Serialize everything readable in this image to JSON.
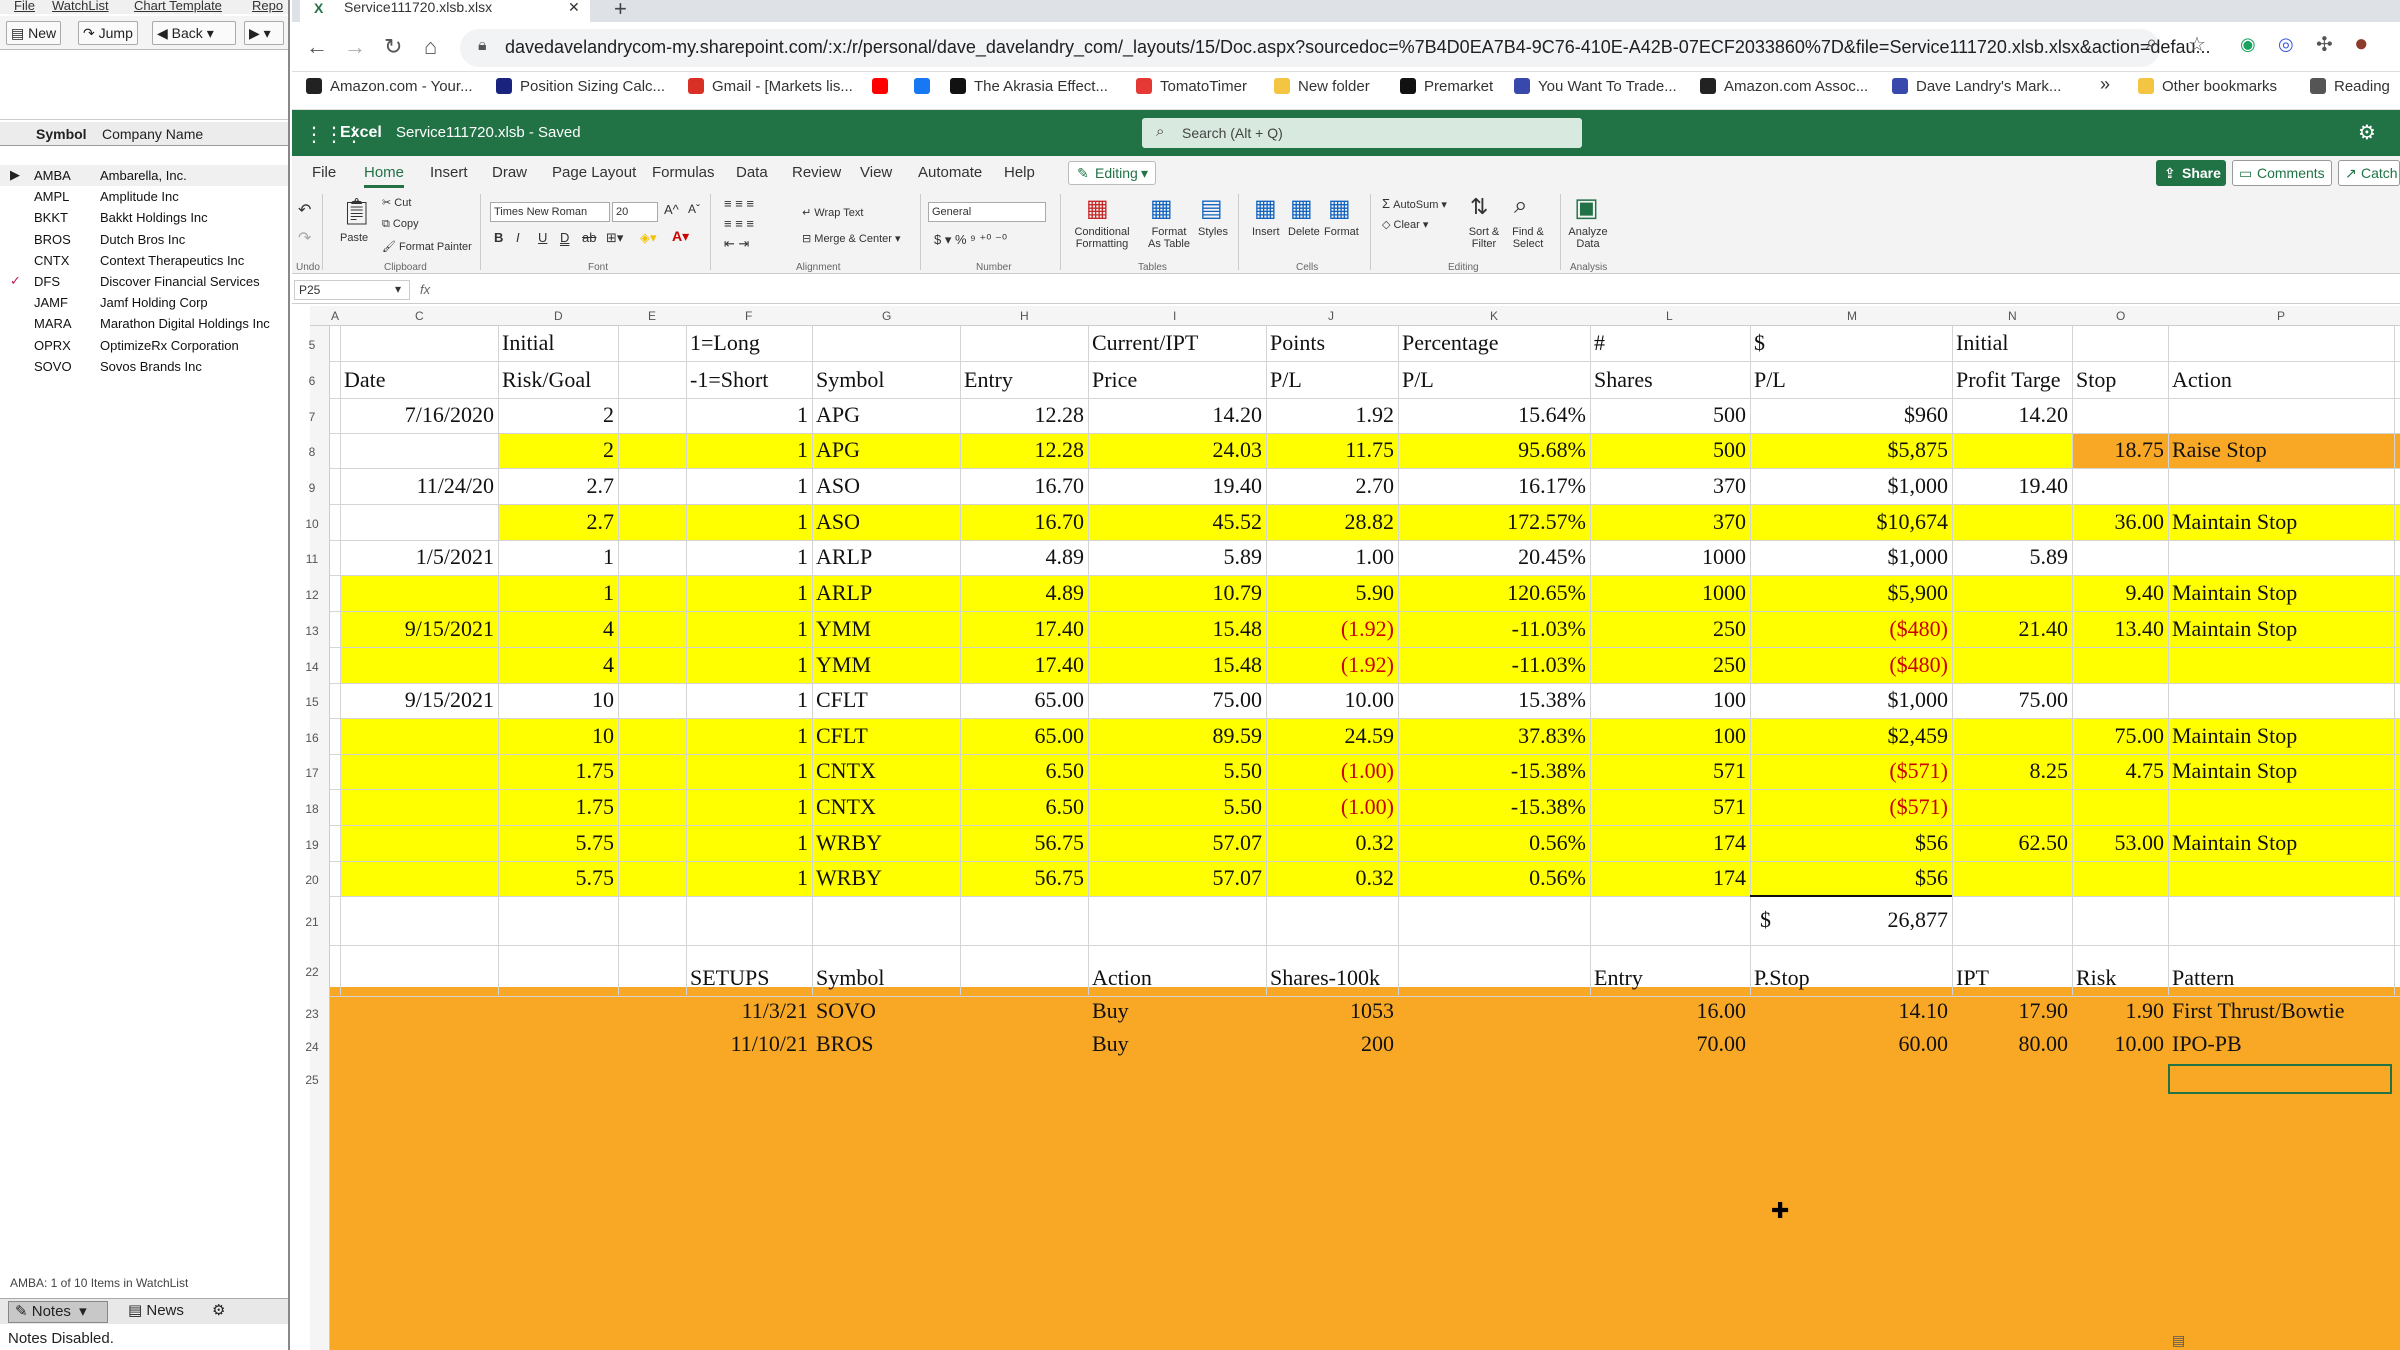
{
  "left_app": {
    "menu": [
      "File",
      "WatchList",
      "Chart Template",
      "Repo"
    ],
    "toolbar": {
      "new": "New",
      "jump": "Jump",
      "back": "Back"
    },
    "columns": {
      "symbol": "Symbol",
      "company": "Company Name"
    },
    "rows": [
      {
        "symbol": "AMBA",
        "name": "Ambarella, Inc.",
        "mark": "▶"
      },
      {
        "symbol": "AMPL",
        "name": "Amplitude Inc",
        "mark": ""
      },
      {
        "symbol": "BKKT",
        "name": "Bakkt Holdings Inc",
        "mark": ""
      },
      {
        "symbol": "BROS",
        "name": "Dutch Bros Inc",
        "mark": ""
      },
      {
        "symbol": "CNTX",
        "name": "Context Therapeutics Inc",
        "mark": ""
      },
      {
        "symbol": "DFS",
        "name": "Discover Financial Services",
        "mark": "✓"
      },
      {
        "symbol": "JAMF",
        "name": "Jamf Holding Corp",
        "mark": ""
      },
      {
        "symbol": "MARA",
        "name": "Marathon Digital Holdings Inc",
        "mark": ""
      },
      {
        "symbol": "OPRX",
        "name": "OptimizeRx Corporation",
        "mark": ""
      },
      {
        "symbol": "SOVO",
        "name": "Sovos Brands Inc",
        "mark": ""
      }
    ],
    "status": "AMBA: 1 of 10 Items in WatchList",
    "notes_label": "Notes",
    "news_label": "News",
    "notes_disabled": "Notes Disabled."
  },
  "browser": {
    "tab_title": "Service111720.xlsb.xlsx",
    "url": "davedavelandrycom-my.sharepoint.com/:x:/r/personal/dave_davelandry_com/_layouts/15/Doc.aspx?sourcedoc=%7B4D0EA7B4-9C76-410E-A42B-07ECF2033860%7D&file=Service111720.xlsb.xlsx&action=defau...",
    "bookmarks": [
      {
        "label": "Amazon.com - Your...",
        "color": "#222"
      },
      {
        "label": "Position Sizing Calc...",
        "color": "#1a237e"
      },
      {
        "label": "Gmail - [Markets lis...",
        "color": "#d93025"
      },
      {
        "label": "",
        "color": "#ff0000"
      },
      {
        "label": "",
        "color": "#1877f2"
      },
      {
        "label": "The Akrasia Effect...",
        "color": "#111"
      },
      {
        "label": "TomatoTimer",
        "color": "#e53935"
      },
      {
        "label": "New folder",
        "color": "#f4c542"
      },
      {
        "label": "Premarket",
        "color": "#111"
      },
      {
        "label": "You Want To Trade...",
        "color": "#3949ab"
      },
      {
        "label": "Amazon.com Assoc...",
        "color": "#222"
      },
      {
        "label": "Dave Landry's Mark...",
        "color": "#3949ab"
      },
      {
        "label": "Other bookmarks",
        "color": "#f4c542"
      },
      {
        "label": "Reading",
        "color": "#555"
      }
    ]
  },
  "excel": {
    "app": "Excel",
    "filename": "Service111720.xlsb - Saved",
    "search_placeholder": "Search (Alt + Q)",
    "tabs": [
      "File",
      "Home",
      "Insert",
      "Draw",
      "Page Layout",
      "Formulas",
      "Data",
      "Review",
      "View",
      "Automate",
      "Help"
    ],
    "editing": "Editing",
    "share": "Share",
    "comments": "Comments",
    "catch": "Catch",
    "ribbon": {
      "undo": "Undo",
      "paste": "Paste",
      "cut": "Cut",
      "copy": "Copy",
      "format_painter": "Format Painter",
      "clipboard": "Clipboard",
      "font_name": "Times New Roman",
      "font_size": "20",
      "font": "Font",
      "wrap_text": "Wrap Text",
      "merge_center": "Merge & Center",
      "alignment": "Alignment",
      "number_format": "General",
      "number": "Number",
      "conditional_formatting": "Conditional Formatting",
      "format_as_table": "Format As Table",
      "styles": "Styles",
      "tables": "Tables",
      "insert": "Insert",
      "delete": "Delete",
      "format": "Format",
      "cells": "Cells",
      "autosum": "AutoSum",
      "clear": "Clear",
      "sort_filter": "Sort & Filter",
      "find_select": "Find & Select",
      "editing_group": "Editing",
      "analyze_data": "Analyze Data",
      "analysis": "Analysis"
    },
    "namebox": "P25",
    "columns": [
      "A",
      "C",
      "D",
      "E",
      "F",
      "G",
      "H",
      "I",
      "J",
      "K",
      "L",
      "M",
      "N",
      "O",
      "P"
    ],
    "header_row5": {
      "D": "Initial",
      "F": "1=Long",
      "I": "Current/IPT",
      "J": "Points",
      "K": "Percentage",
      "L": "#",
      "M": "$",
      "N": "Initial"
    },
    "header_row6": {
      "C": "Date",
      "D": "Risk/Goal",
      "F": "-1=Short",
      "G": "Symbol",
      "H": "Entry",
      "I": "Price",
      "J": "P/L",
      "K": "P/L",
      "L": "Shares",
      "M": "P/L",
      "N": "Profit Targe",
      "O": "Stop",
      "P": "Action"
    },
    "trades": [
      {
        "row": "7",
        "date": "7/16/2020",
        "risk": "2",
        "ls": "1",
        "sym": "APG",
        "entry": "12.28",
        "price": "14.20",
        "pts": "1.92",
        "pct": "15.64%",
        "shares": "500",
        "pl": "$960",
        "target": "14.20",
        "stop": "",
        "action": "",
        "yellow": false,
        "neg": false
      },
      {
        "row": "8",
        "date": "",
        "risk": "2",
        "ls": "1",
        "sym": "APG",
        "entry": "12.28",
        "price": "24.03",
        "pts": "11.75",
        "pct": "95.68%",
        "shares": "500",
        "pl": "$5,875",
        "target": "",
        "stop": "18.75",
        "action": "Raise Stop",
        "yellow": true,
        "neg": false
      },
      {
        "row": "9",
        "date": "11/24/20",
        "risk": "2.7",
        "ls": "1",
        "sym": "ASO",
        "entry": "16.70",
        "price": "19.40",
        "pts": "2.70",
        "pct": "16.17%",
        "shares": "370",
        "pl": "$1,000",
        "target": "19.40",
        "stop": "",
        "action": "",
        "yellow": false,
        "neg": false
      },
      {
        "row": "10",
        "date": "",
        "risk": "2.7",
        "ls": "1",
        "sym": "ASO",
        "entry": "16.70",
        "price": "45.52",
        "pts": "28.82",
        "pct": "172.57%",
        "shares": "370",
        "pl": "$10,674",
        "target": "",
        "stop": "36.00",
        "action": "Maintain Stop",
        "yellow": true,
        "neg": false
      },
      {
        "row": "11",
        "date": "1/5/2021",
        "risk": "1",
        "ls": "1",
        "sym": "ARLP",
        "entry": "4.89",
        "price": "5.89",
        "pts": "1.00",
        "pct": "20.45%",
        "shares": "1000",
        "pl": "$1,000",
        "target": "5.89",
        "stop": "",
        "action": "",
        "yellow": false,
        "neg": false
      },
      {
        "row": "12",
        "date": "",
        "risk": "1",
        "ls": "1",
        "sym": "ARLP",
        "entry": "4.89",
        "price": "10.79",
        "pts": "5.90",
        "pct": "120.65%",
        "shares": "1000",
        "pl": "$5,900",
        "target": "",
        "stop": "9.40",
        "action": "Maintain Stop",
        "yellow": true,
        "neg": false
      },
      {
        "row": "13",
        "date": "9/15/2021",
        "risk": "4",
        "ls": "1",
        "sym": "YMM",
        "entry": "17.40",
        "price": "15.48",
        "pts": "(1.92)",
        "pct": "-11.03%",
        "shares": "250",
        "pl": "($480)",
        "target": "21.40",
        "stop": "13.40",
        "action": "Maintain Stop",
        "yellow": true,
        "neg": true
      },
      {
        "row": "14",
        "date": "",
        "risk": "4",
        "ls": "1",
        "sym": "YMM",
        "entry": "17.40",
        "price": "15.48",
        "pts": "(1.92)",
        "pct": "-11.03%",
        "shares": "250",
        "pl": "($480)",
        "target": "",
        "stop": "",
        "action": "",
        "yellow": true,
        "neg": true
      },
      {
        "row": "15",
        "date": "9/15/2021",
        "risk": "10",
        "ls": "1",
        "sym": "CFLT",
        "entry": "65.00",
        "price": "75.00",
        "pts": "10.00",
        "pct": "15.38%",
        "shares": "100",
        "pl": "$1,000",
        "target": "75.00",
        "stop": "",
        "action": "",
        "yellow": false,
        "neg": false
      },
      {
        "row": "16",
        "date": "",
        "risk": "10",
        "ls": "1",
        "sym": "CFLT",
        "entry": "65.00",
        "price": "89.59",
        "pts": "24.59",
        "pct": "37.83%",
        "shares": "100",
        "pl": "$2,459",
        "target": "",
        "stop": "75.00",
        "action": "Maintain Stop",
        "yellow": true,
        "neg": false
      },
      {
        "row": "17",
        "date": "",
        "risk": "1.75",
        "ls": "1",
        "sym": "CNTX",
        "entry": "6.50",
        "price": "5.50",
        "pts": "(1.00)",
        "pct": "-15.38%",
        "shares": "571",
        "pl": "($571)",
        "target": "8.25",
        "stop": "4.75",
        "action": "Maintain Stop",
        "yellow": true,
        "neg": true
      },
      {
        "row": "18",
        "date": "",
        "risk": "1.75",
        "ls": "1",
        "sym": "CNTX",
        "entry": "6.50",
        "price": "5.50",
        "pts": "(1.00)",
        "pct": "-15.38%",
        "shares": "571",
        "pl": "($571)",
        "target": "",
        "stop": "",
        "action": "",
        "yellow": true,
        "neg": true
      },
      {
        "row": "19",
        "date": "",
        "risk": "5.75",
        "ls": "1",
        "sym": "WRBY",
        "entry": "56.75",
        "price": "57.07",
        "pts": "0.32",
        "pct": "0.56%",
        "shares": "174",
        "pl": "$56",
        "target": "62.50",
        "stop": "53.00",
        "action": "Maintain Stop",
        "yellow": true,
        "neg": false
      },
      {
        "row": "20",
        "date": "",
        "risk": "5.75",
        "ls": "1",
        "sym": "WRBY",
        "entry": "56.75",
        "price": "57.07",
        "pts": "0.32",
        "pct": "0.56%",
        "shares": "174",
        "pl": "$56",
        "target": "",
        "stop": "",
        "action": "",
        "yellow": true,
        "neg": false
      }
    ],
    "total": {
      "row": "21",
      "symbol": "$",
      "value": "26,877"
    },
    "setups_header": {
      "row": "22",
      "F": "SETUPS",
      "G": "Symbol",
      "I": "Action",
      "J": "Shares-100k",
      "L": "Entry",
      "M": "P.Stop",
      "N": "IPT",
      "O": "Risk",
      "P": "Pattern"
    },
    "setups": [
      {
        "row": "23",
        "date": "11/3/21",
        "sym": "SOVO",
        "action": "Buy",
        "shares": "1053",
        "entry": "16.00",
        "pstop": "14.10",
        "ipt": "17.90",
        "risk": "1.90",
        "pattern": "First Thrust/Bowtie"
      },
      {
        "row": "24",
        "date": "11/10/21",
        "sym": "BROS",
        "action": "Buy",
        "shares": "200",
        "entry": "70.00",
        "pstop": "60.00",
        "ipt": "80.00",
        "risk": "10.00",
        "pattern": "IPO-PB"
      }
    ],
    "empty_rows": [
      "25"
    ],
    "colors": {
      "excel_green": "#217346",
      "yellow": "#ffff00",
      "orange": "#f9a825",
      "neg_red": "#cc0000"
    }
  }
}
